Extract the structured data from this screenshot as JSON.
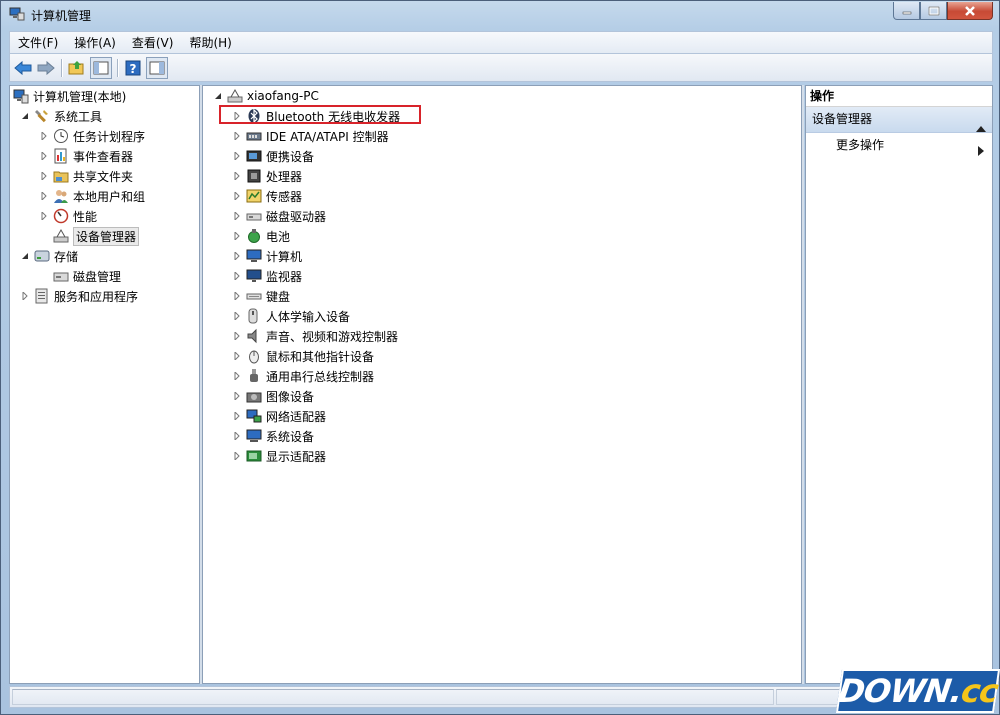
{
  "window": {
    "title": "计算机管理"
  },
  "menubar": {
    "items": [
      "文件(F)",
      "操作(A)",
      "查看(V)",
      "帮助(H)"
    ]
  },
  "left_tree": {
    "root": "计算机管理(本地)",
    "system_tools": "系统工具",
    "task_scheduler": "任务计划程序",
    "event_viewer": "事件查看器",
    "shared_folders": "共享文件夹",
    "local_users": "本地用户和组",
    "performance": "性能",
    "device_manager": "设备管理器",
    "storage": "存储",
    "disk_management": "磁盘管理",
    "services_apps": "服务和应用程序"
  },
  "device_tree": {
    "computer": "xiaofang-PC",
    "categories": [
      "Bluetooth 无线电收发器",
      "IDE ATA/ATAPI 控制器",
      "便携设备",
      "处理器",
      "传感器",
      "磁盘驱动器",
      "电池",
      "计算机",
      "监视器",
      "键盘",
      "人体学输入设备",
      "声音、视频和游戏控制器",
      "鼠标和其他指针设备",
      "通用串行总线控制器",
      "图像设备",
      "网络适配器",
      "系统设备",
      "显示适配器"
    ]
  },
  "actions_pane": {
    "header": "操作",
    "section": "设备管理器",
    "more_actions": "更多操作"
  },
  "watermark": {
    "text_main": "DOWN",
    "text_dot": ".",
    "text_cc": "cc"
  }
}
